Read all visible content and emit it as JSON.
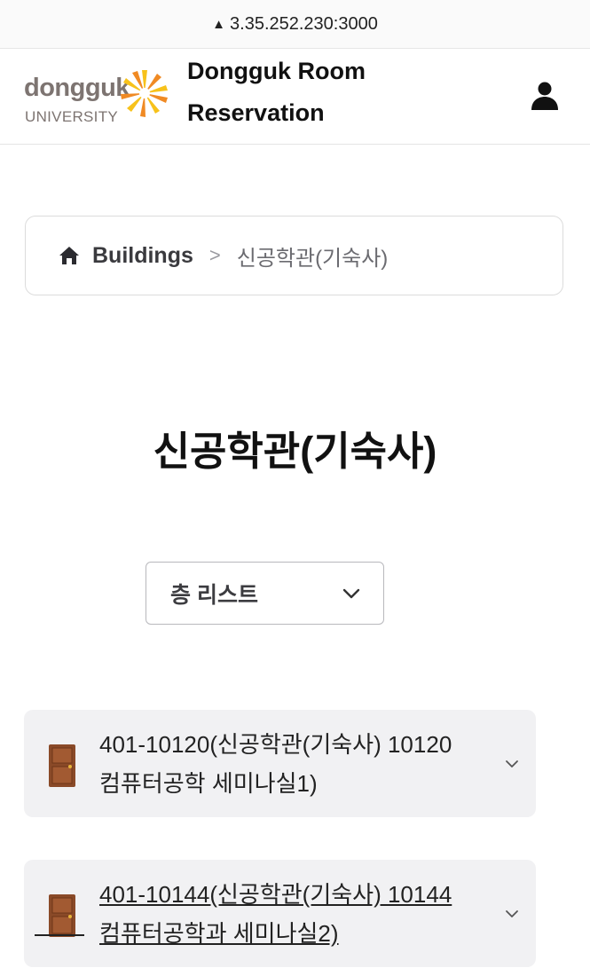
{
  "browser": {
    "url": "3.35.252.230:3000",
    "warning_icon": "warning-triangle-icon"
  },
  "header": {
    "logo_word": "dongguk",
    "logo_sub": "UNIVERSITY",
    "title_line1": "Dongguk Room",
    "title_line2": "Reservation",
    "user_icon": "user-icon",
    "colors": {
      "logo_gray": "#7d7471",
      "logo_orange": "#f08a24",
      "logo_yellow": "#f7c21b"
    }
  },
  "breadcrumb": {
    "home_icon": "home-icon",
    "root_label": "Buildings",
    "separator": ">",
    "current_label": "신공학관(기숙사)"
  },
  "main": {
    "title": "신공학관(기숙사)",
    "floor_select": {
      "selected": "층 리스트",
      "icon": "chevron-down-icon"
    },
    "rooms": [
      {
        "line1": "401-10120(신공학관(기숙사) 10120",
        "line2": "컴퓨터공학 세미나실1)",
        "icon": "door-icon"
      },
      {
        "line1": "401-10144(신공학관(기숙사) 10144",
        "line2": "컴퓨터공학과 세미나실2)",
        "icon": "door-icon"
      }
    ]
  }
}
